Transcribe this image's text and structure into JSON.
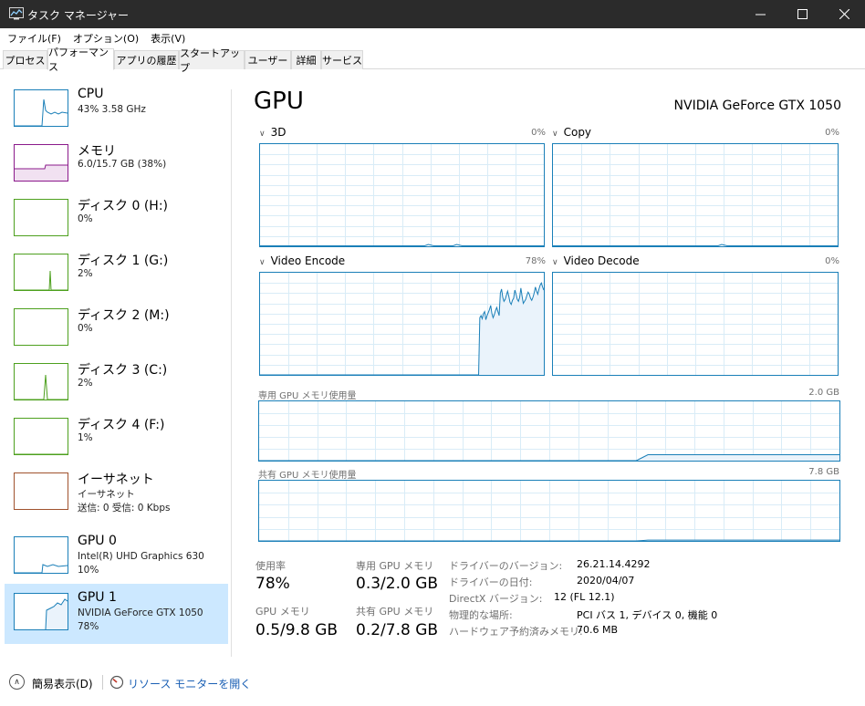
{
  "window": {
    "title": "タスク マネージャー",
    "minimize": "─",
    "maximize": "☐",
    "close": "✕"
  },
  "menu": [
    "ファイル(F)",
    "オプション(O)",
    "表示(V)"
  ],
  "tabs": [
    "プロセス",
    "パフォーマンス",
    "アプリの履歴",
    "スタートアップ",
    "ユーザー",
    "詳細",
    "サービス"
  ],
  "sidebar": {
    "items": [
      {
        "name": "CPU",
        "line1": "43%  3.58 GHz",
        "line2": "",
        "color": "#1a7fb8"
      },
      {
        "name": "メモリ",
        "line1": "6.0/15.7 GB (38%)",
        "line2": "",
        "color": "#8b1a8b"
      },
      {
        "name": "ディスク 0 (H:)",
        "line1": "0%",
        "line2": "",
        "color": "#4da01e"
      },
      {
        "name": "ディスク 1 (G:)",
        "line1": "2%",
        "line2": "",
        "color": "#4da01e"
      },
      {
        "name": "ディスク 2 (M:)",
        "line1": "0%",
        "line2": "",
        "color": "#4da01e"
      },
      {
        "name": "ディスク 3 (C:)",
        "line1": "2%",
        "line2": "",
        "color": "#4da01e"
      },
      {
        "name": "ディスク 4 (F:)",
        "line1": "1%",
        "line2": "",
        "color": "#4da01e"
      },
      {
        "name": "イーサネット",
        "line1": "イーサネット",
        "line2": "送信: 0  受信: 0 Kbps",
        "color": "#a0522d"
      },
      {
        "name": "GPU 0",
        "line1": "Intel(R) UHD Graphics 630",
        "line2": "10%",
        "color": "#1a7fb8"
      },
      {
        "name": "GPU 1",
        "line1": "NVIDIA GeForce GTX 1050",
        "line2": "78%",
        "color": "#1a7fb8"
      }
    ]
  },
  "main": {
    "title": "GPU",
    "model": "NVIDIA GeForce GTX 1050",
    "engines": [
      {
        "label": "3D",
        "pct": "0%"
      },
      {
        "label": "Copy",
        "pct": "0%"
      },
      {
        "label": "Video Encode",
        "pct": "78%"
      },
      {
        "label": "Video Decode",
        "pct": "0%"
      }
    ],
    "dedicated": {
      "label": "専用 GPU メモリ使用量",
      "max": "2.0 GB"
    },
    "shared": {
      "label": "共有 GPU メモリ使用量",
      "max": "7.8 GB"
    }
  },
  "stats": {
    "usage_label": "使用率",
    "usage": "78%",
    "dedicated_label": "専用 GPU メモリ",
    "dedicated": "0.3/2.0 GB",
    "gpu_mem_label": "GPU メモリ",
    "gpu_mem": "0.5/9.8 GB",
    "shared_label": "共有 GPU メモリ",
    "shared": "0.2/7.8 GB"
  },
  "info": [
    {
      "label": "ドライバーのバージョン:",
      "value": "26.21.14.4292"
    },
    {
      "label": "ドライバーの日付:",
      "value": "2020/04/07"
    },
    {
      "label": "DirectX バージョン:",
      "value": "12 (FL 12.1)"
    },
    {
      "label": "物理的な場所:",
      "value": "PCI バス 1, デバイス 0, 機能 0"
    },
    {
      "label": "ハードウェア予約済みメモリ:",
      "value": "70.6 MB"
    }
  ],
  "footer": {
    "fewer": "簡易表示(D)",
    "resmon": "リソース モニターを開く"
  },
  "colors": {
    "gpu_line": "#1a7fb8",
    "gpu_fill": "#eaf3fb",
    "grid": "#d9ecf7",
    "selected_bg": "#cce8ff"
  },
  "chart_data": [
    {
      "type": "area",
      "title": "Video Encode",
      "ylim": [
        0,
        100
      ],
      "max_label": "78%",
      "values": [
        0,
        0,
        0,
        0,
        0,
        0,
        0,
        0,
        0,
        0,
        0,
        0,
        0,
        0,
        0,
        0,
        0,
        0,
        0,
        0,
        0,
        0,
        0,
        0,
        0,
        0,
        0,
        0,
        0,
        0,
        0,
        0,
        0,
        0,
        0,
        0,
        0,
        0,
        0,
        0,
        0,
        0,
        0,
        0,
        0,
        0,
        0,
        0,
        0,
        0,
        0,
        0,
        0,
        0,
        0,
        0,
        0,
        0,
        0,
        0,
        0,
        0,
        0,
        0,
        0,
        0,
        0,
        0,
        0,
        0,
        0,
        0,
        0,
        0,
        0,
        0,
        0,
        0,
        0,
        0,
        0,
        0,
        0,
        0,
        0,
        0,
        0,
        0,
        0,
        0,
        0,
        0,
        0,
        0,
        0,
        0,
        0,
        0,
        0,
        0,
        0,
        0,
        0,
        0,
        0,
        0,
        0,
        0,
        0,
        0,
        0,
        0,
        0,
        0,
        0,
        0,
        0,
        0,
        0,
        0,
        0,
        0,
        0,
        0,
        0,
        0,
        0,
        0,
        0,
        0,
        0,
        0,
        0,
        0,
        0,
        0,
        0,
        0,
        0,
        0,
        0,
        0,
        0,
        0,
        0,
        0,
        0,
        0,
        0,
        0,
        0,
        0,
        0,
        0,
        0,
        0,
        0,
        0,
        0,
        0,
        0,
        0,
        0,
        0,
        0,
        0,
        0,
        0,
        0,
        0,
        0,
        0,
        0,
        0,
        0,
        0,
        0,
        0,
        0,
        0,
        0,
        0,
        56,
        58,
        55,
        60,
        62,
        54,
        58,
        61,
        64,
        68,
        60,
        56,
        59,
        63,
        66,
        62,
        58,
        80,
        84,
        76,
        72,
        74,
        78,
        82,
        77,
        71,
        69,
        73,
        75,
        83,
        79,
        74,
        72,
        76,
        85,
        77,
        70,
        72,
        74,
        78,
        81,
        79,
        75,
        73,
        76,
        80,
        86,
        82,
        79,
        84,
        88,
        90,
        86,
        83
      ]
    },
    {
      "type": "area",
      "title": "専用 GPU メモリ使用量",
      "ylim": [
        0,
        2.0
      ],
      "max_label": "2.0 GB",
      "values": [
        0,
        0,
        0,
        0,
        0,
        0,
        0,
        0,
        0,
        0,
        0,
        0,
        0,
        0,
        0,
        0,
        0,
        0,
        0,
        0,
        0,
        0,
        0,
        0,
        0,
        0,
        0,
        0,
        0,
        0,
        0,
        0,
        0,
        0,
        0,
        0,
        0,
        0,
        0,
        0,
        0,
        0,
        0,
        0,
        0,
        0,
        0,
        0,
        0,
        0,
        0,
        0,
        0,
        0,
        0,
        0,
        0,
        0,
        0,
        0,
        0,
        0,
        0,
        0,
        0,
        0,
        0.1,
        0.2,
        0.2,
        0.2,
        0.2,
        0.2,
        0.2,
        0.2,
        0.2,
        0.2,
        0.2,
        0.2,
        0.2,
        0.2,
        0.2,
        0.2,
        0.2,
        0.2,
        0.2,
        0.2,
        0.2,
        0.2,
        0.2,
        0.2,
        0.2,
        0.2,
        0.2,
        0.2,
        0.2,
        0.2,
        0.2,
        0.2,
        0.2,
        0.2,
        0.2
      ]
    },
    {
      "type": "area",
      "title": "共有 GPU メモリ使用量",
      "ylim": [
        0,
        7.8
      ],
      "max_label": "7.8 GB",
      "values": [
        0,
        0,
        0,
        0,
        0,
        0,
        0,
        0,
        0,
        0,
        0,
        0,
        0,
        0,
        0,
        0,
        0,
        0,
        0,
        0,
        0,
        0,
        0,
        0,
        0,
        0,
        0,
        0,
        0,
        0,
        0,
        0,
        0,
        0,
        0,
        0,
        0,
        0,
        0,
        0,
        0,
        0,
        0,
        0,
        0,
        0,
        0,
        0,
        0,
        0,
        0,
        0,
        0,
        0,
        0,
        0,
        0,
        0,
        0,
        0,
        0,
        0,
        0,
        0,
        0,
        0,
        0.05,
        0.1,
        0.1,
        0.1,
        0.1,
        0.1,
        0.1,
        0.1,
        0.1,
        0.1,
        0.1,
        0.1,
        0.1,
        0.1,
        0.1,
        0.1,
        0.1,
        0.1,
        0.1,
        0.1,
        0.1,
        0.1,
        0.1,
        0.1,
        0.1,
        0.1,
        0.1,
        0.1,
        0.1,
        0.1,
        0.1,
        0.1,
        0.1,
        0.1,
        0.1
      ]
    }
  ]
}
